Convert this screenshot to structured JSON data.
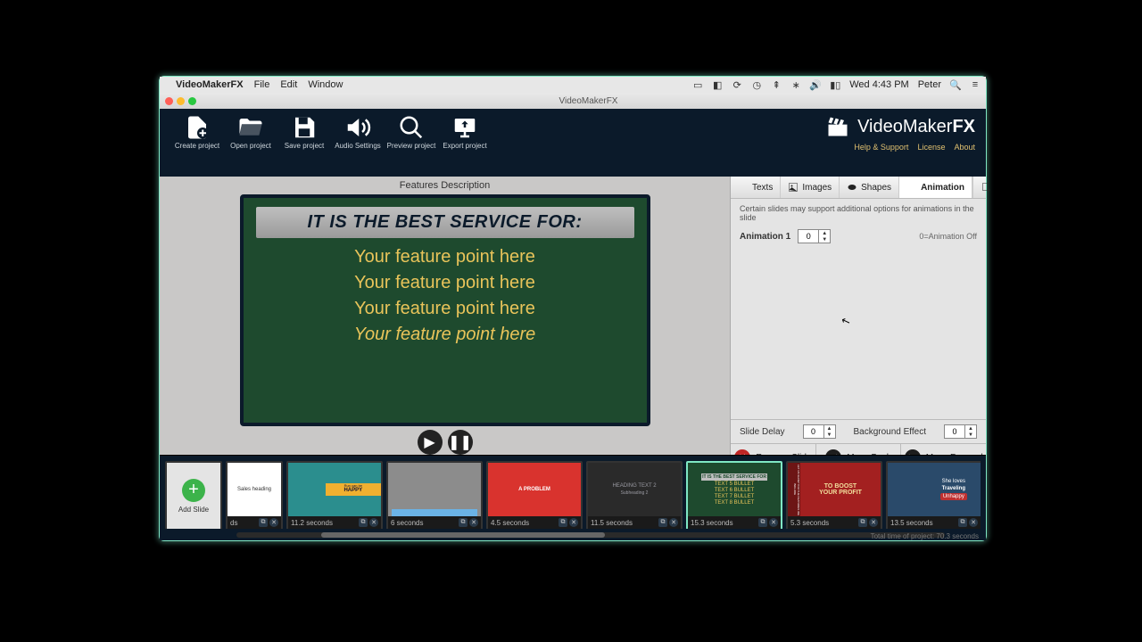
{
  "menubar": {
    "app": "VideoMakerFX",
    "items": [
      "File",
      "Edit",
      "Window"
    ],
    "clock": "Wed 4:43 PM",
    "user": "Peter"
  },
  "window": {
    "title": "VideoMakerFX"
  },
  "toolbar": {
    "create": "Create project",
    "open": "Open project",
    "save": "Save project",
    "audio": "Audio Settings",
    "preview": "Preview project",
    "export": "Export project"
  },
  "brand": {
    "name": "VideoMaker",
    "suffix": "FX",
    "links": [
      "Help & Support",
      "License",
      "About"
    ]
  },
  "canvas": {
    "title": "Features Description",
    "heading": "IT IS THE BEST SERVICE FOR:",
    "bullets": [
      "Your feature point here",
      "Your feature point here",
      "Your feature point here",
      "Your feature point here"
    ]
  },
  "panel": {
    "tabs": [
      "Texts",
      "Images",
      "Shapes",
      "Animation"
    ],
    "hint": "Certain slides may support additional options for animations in the slide",
    "anim_label": "Animation 1",
    "anim_value": "0",
    "anim_off": "0=Animation Off",
    "slide_delay_label": "Slide Delay",
    "slide_delay_value": "0",
    "bg_effect_label": "Background Effect",
    "bg_effect_value": "0",
    "remove": "Remove Slide",
    "back": "Move Back",
    "forward": "Move Forward"
  },
  "timeline": {
    "add_label": "Add Slide",
    "slides": [
      {
        "dur": "ds"
      },
      {
        "dur": "11.2 seconds"
      },
      {
        "dur": "6 seconds"
      },
      {
        "dur": "4.5 seconds"
      },
      {
        "dur": "11.5 seconds"
      },
      {
        "dur": "15.3 seconds"
      },
      {
        "dur": "5.3 seconds"
      },
      {
        "dur": "13.5 seconds"
      }
    ],
    "thumbs": {
      "t0": "Sales heading",
      "t1_top": "Run can be",
      "t1_big": "HAPPY",
      "t3": "A PROBLEM",
      "t4a": "HEADING TEXT 2",
      "t4b": "Subheading 2",
      "t5_h": "IT IS THE BEST SERVICE FOR",
      "t5_1": "TEXT 5 BULLET",
      "t5_2": "TEXT 6 BULLET",
      "t5_3": "TEXT 7 BULLET",
      "t5_4": "TEXT 8 BULLET",
      "t6_side": "LET US SHOW YOU THE FEATURES WE INCLUDE",
      "t6_a": "TO BOOST",
      "t6_b": "YOUR PROFIT",
      "t7_a": "She loves",
      "t7_b": "Traveling",
      "t7_c": "Unhappy"
    },
    "total": "Total time of project: 70.3 seconds"
  }
}
